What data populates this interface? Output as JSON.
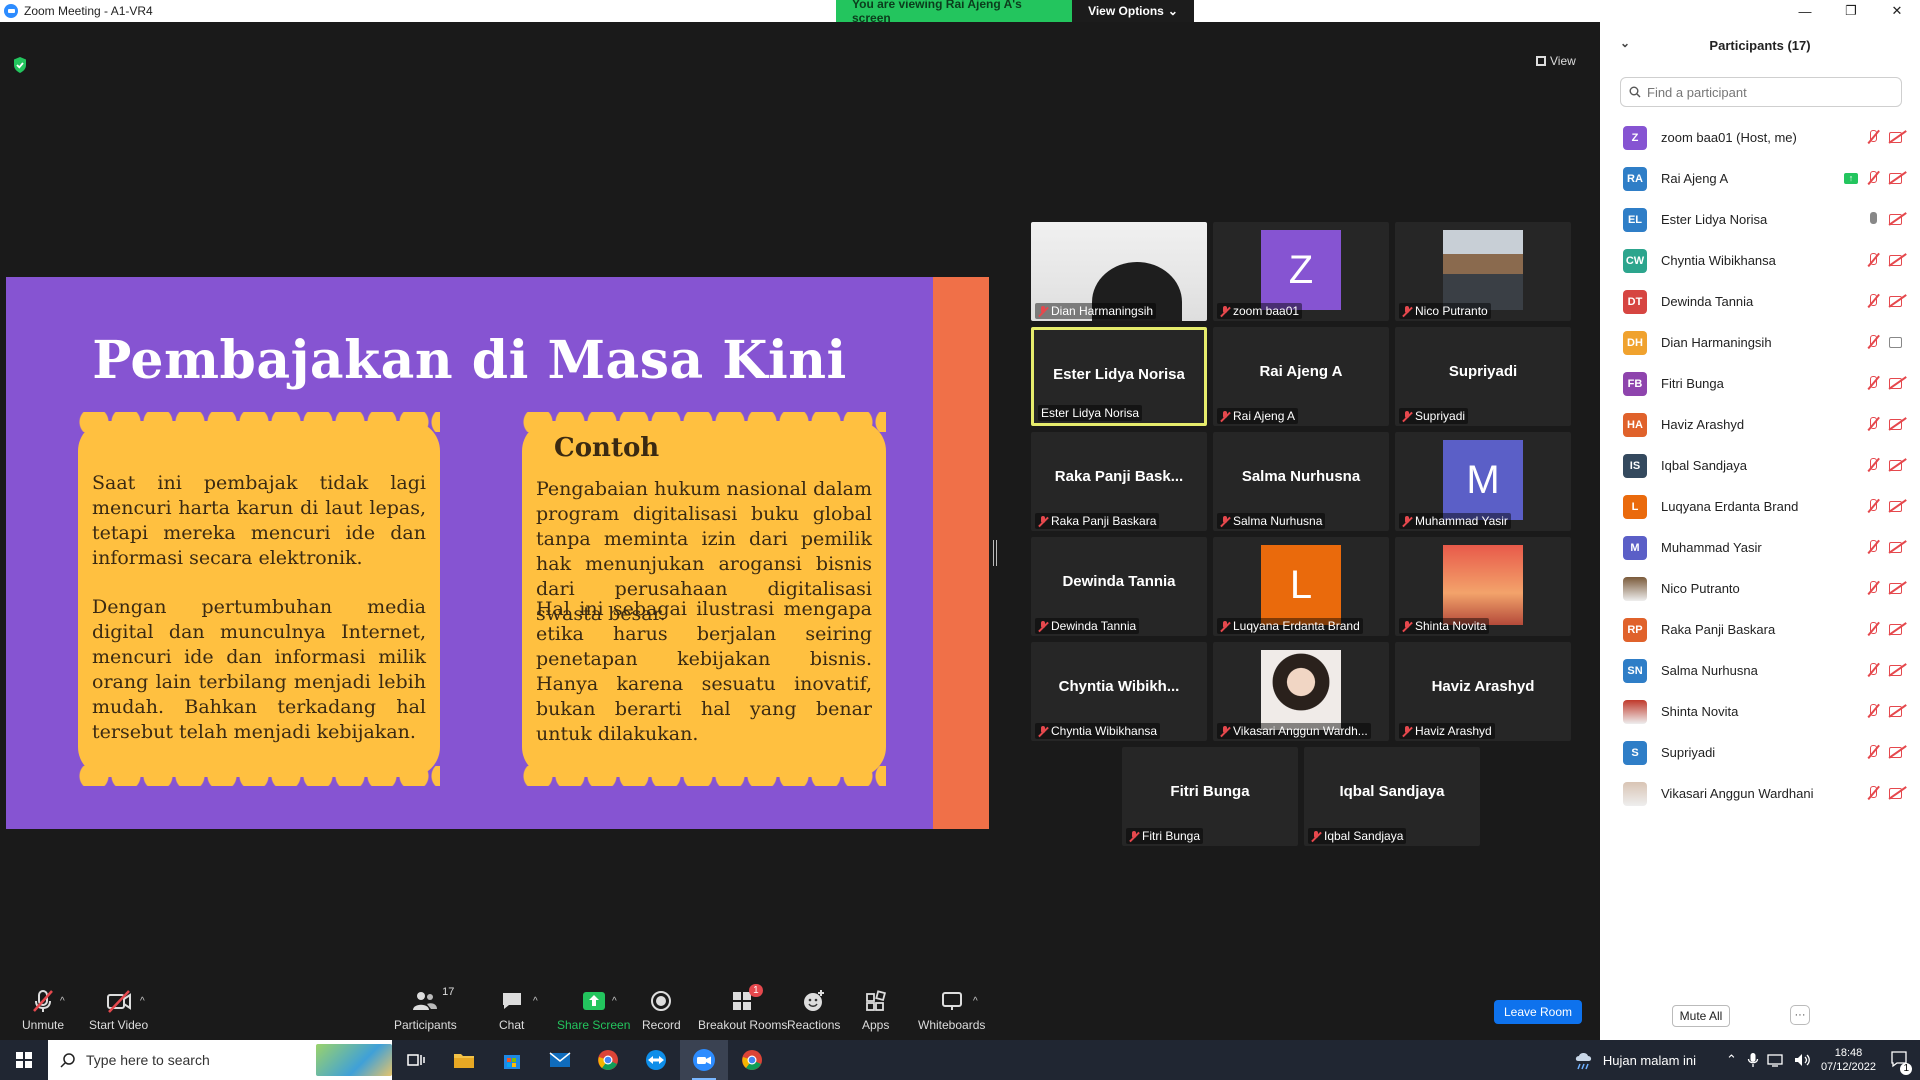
{
  "window": {
    "title": "Zoom Meeting - A1-VR4"
  },
  "share_banner": {
    "viewing_text": "You are viewing Rai Ajeng A's screen",
    "view_options_label": "View Options"
  },
  "meeting": {
    "view_label": "View"
  },
  "slide": {
    "title": "Pembajakan di Masa Kini",
    "card1_p1": "Saat ini pembajak tidak lagi mencuri harta karun di laut lepas, tetapi mereka mencuri ide dan informasi secara elektronik.",
    "card1_p2": "Dengan pertumbuhan media digital dan munculnya Internet, mencuri ide dan informasi milik orang lain terbilang menjadi lebih mudah. Bahkan terkadang hal tersebut telah menjadi kebijakan.",
    "card2_heading": "Contoh",
    "card2_p1": "Pengabaian hukum nasional dalam program digitalisasi buku global tanpa meminta izin dari pemilik hak menunjukan arogansi bisnis dari perusahaan digitalisasi swasta besar.",
    "card2_p2": "Hal ini sebagai ilustrasi mengapa etika harus berjalan seiring penetapan kebijakan bisnis. Hanya karena sesuatu inovatif, bukan berarti hal yang benar untuk dilakukan.",
    "colors": {
      "background": "#8654d2",
      "stripe": "#f07048",
      "card": "#ffc040"
    }
  },
  "gallery": [
    {
      "label": "Dian Harmaningsih",
      "type": "camera"
    },
    {
      "label": "zoom baa01",
      "type": "avatar",
      "initial": "Z",
      "color": "#8654d2"
    },
    {
      "label": "Nico Putranto",
      "type": "photo"
    },
    {
      "label": "Ester Lidya Norisa",
      "type": "name",
      "bigname": "Ester Lidya Norisa",
      "active": true
    },
    {
      "label": "Rai Ajeng A",
      "type": "name",
      "bigname": "Rai Ajeng A"
    },
    {
      "label": "Supriyadi",
      "type": "name",
      "bigname": "Supriyadi"
    },
    {
      "label": "Raka Panji Baskara",
      "type": "name",
      "bigname": "Raka Panji Bask..."
    },
    {
      "label": "Salma Nurhusna",
      "type": "name",
      "bigname": "Salma Nurhusna"
    },
    {
      "label": "Muhammad Yasir",
      "type": "avatar",
      "initial": "M",
      "color": "#5b5fc7"
    },
    {
      "label": "Dewinda Tannia",
      "type": "name",
      "bigname": "Dewinda Tannia"
    },
    {
      "label": "Luqyana Erdanta Brand",
      "type": "avatar",
      "initial": "L",
      "color": "#ea6a0c"
    },
    {
      "label": "Shinta Novita",
      "type": "photo2"
    },
    {
      "label": "Chyntia Wibikhansa",
      "type": "name",
      "bigname": "Chyntia  Wibikh..."
    },
    {
      "label": "Vikasari Anggun Wardh...",
      "type": "photo3"
    },
    {
      "label": "Haviz Arashyd",
      "type": "name",
      "bigname": "Haviz Arashyd"
    },
    {
      "label": "Fitri Bunga",
      "type": "name",
      "bigname": "Fitri Bunga"
    },
    {
      "label": "Iqbal Sandjaya",
      "type": "name",
      "bigname": "Iqbal Sandjaya"
    }
  ],
  "toolbar": {
    "unmute": "Unmute",
    "start_video": "Start Video",
    "participants": "Participants",
    "participants_count": "17",
    "chat": "Chat",
    "share_screen": "Share Screen",
    "record": "Record",
    "breakout_rooms": "Breakout Rooms",
    "breakout_badge": "1",
    "reactions": "Reactions",
    "apps": "Apps",
    "whiteboards": "Whiteboards",
    "leave_room": "Leave Room"
  },
  "panel": {
    "title": "Participants (17)",
    "search_placeholder": "Find a participant",
    "mute_all": "Mute All",
    "more": "···",
    "participants": [
      {
        "initials": "Z",
        "name": "zoom baa01 (Host, me)",
        "color": "#8654d2",
        "mic": "off",
        "cam": "off"
      },
      {
        "initials": "RA",
        "name": "Rai Ajeng A",
        "color": "#2f7ec7",
        "mic": "off",
        "cam": "off",
        "sharing": true
      },
      {
        "initials": "EL",
        "name": "Ester Lidya Norisa",
        "color": "#2f7ec7",
        "mic": "on",
        "cam": "off"
      },
      {
        "initials": "CW",
        "name": "Chyntia Wibikhansa",
        "color": "#2ca58d",
        "mic": "off",
        "cam": "off"
      },
      {
        "initials": "DT",
        "name": "Dewinda Tannia",
        "color": "#d64541",
        "mic": "off",
        "cam": "off"
      },
      {
        "initials": "DH",
        "name": "Dian Harmaningsih",
        "color": "#f0a22e",
        "mic": "off",
        "cam": "on"
      },
      {
        "initials": "FB",
        "name": "Fitri Bunga",
        "color": "#8e44ad",
        "mic": "off",
        "cam": "off"
      },
      {
        "initials": "HA",
        "name": "Haviz Arashyd",
        "color": "#e0622b",
        "mic": "off",
        "cam": "off"
      },
      {
        "initials": "IS",
        "name": "Iqbal Sandjaya",
        "color": "#34495e",
        "mic": "off",
        "cam": "off"
      },
      {
        "initials": "L",
        "name": "Luqyana Erdanta Brand",
        "color": "#ea6a0c",
        "mic": "off",
        "cam": "off"
      },
      {
        "initials": "M",
        "name": "Muhammad Yasir",
        "color": "#5b5fc7",
        "mic": "off",
        "cam": "off"
      },
      {
        "initials": "",
        "name": "Nico Putranto",
        "color": "#7a5a3a",
        "mic": "off",
        "cam": "off",
        "photo": true
      },
      {
        "initials": "RP",
        "name": "Raka Panji Baskara",
        "color": "#e0622b",
        "mic": "off",
        "cam": "off"
      },
      {
        "initials": "SN",
        "name": "Salma Nurhusna",
        "color": "#2f7ec7",
        "mic": "off",
        "cam": "off"
      },
      {
        "initials": "",
        "name": "Shinta Novita",
        "color": "#c0392b",
        "mic": "off",
        "cam": "off",
        "photo": true
      },
      {
        "initials": "S",
        "name": "Supriyadi",
        "color": "#2f7ec7",
        "mic": "off",
        "cam": "off"
      },
      {
        "initials": "",
        "name": "Vikasari Anggun Wardhani",
        "color": "#d9c4b4",
        "mic": "off",
        "cam": "off",
        "photo": true
      }
    ]
  },
  "taskbar": {
    "search_placeholder": "Type here to search",
    "weather": "Hujan malam ini",
    "time": "18:48",
    "date": "07/12/2022",
    "notif_count": "1"
  }
}
